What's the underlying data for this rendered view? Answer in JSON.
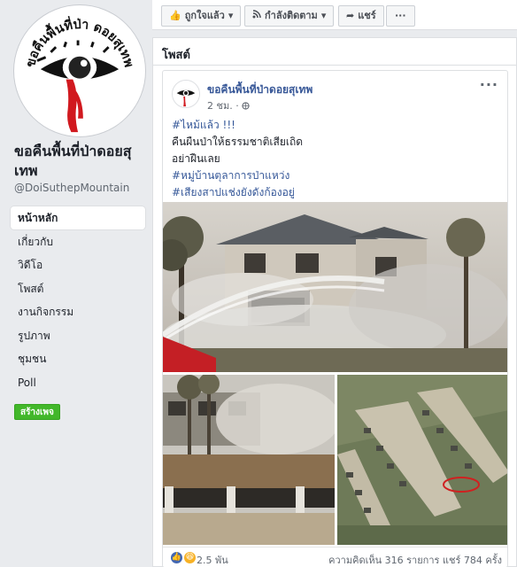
{
  "page": {
    "avatar_text": "ขอคืนพื้นที่ป่า ดอยสุเทพ",
    "name": "ขอคืนพื้นที่ป่าดอยสุเทพ",
    "handle": "@DoiSuthepMountain",
    "create_page_label": "สร้างเพจ"
  },
  "nav": {
    "items": [
      {
        "label": "หน้าหลัก",
        "active": true
      },
      {
        "label": "เกี่ยวกับ"
      },
      {
        "label": "วิดีโอ"
      },
      {
        "label": "โพสต์"
      },
      {
        "label": "งานกิจกรรม"
      },
      {
        "label": "รูปภาพ"
      },
      {
        "label": "ชุมชน"
      },
      {
        "label": "Poll"
      }
    ]
  },
  "top_bar": {
    "like_label": "ถูกใจแล้ว",
    "follow_label": "กำลังติดตาม",
    "share_label": "แชร์",
    "more_label": "···"
  },
  "posts": {
    "section_title": "โพสต์",
    "post": {
      "author": "ขอคืนพื้นที่ป่าดอยสุเทพ",
      "time": "2 ชม.",
      "privacy_sep": "·",
      "text_lines": [
        "#ไหม้แล้ว !!!",
        "คืนผืนป่าให้ธรรมชาติเสียเถิด",
        "อย่าฝืนเลย",
        "#หมู่บ้านตุลาการป่าแหว่ง",
        "#เสียงสาปแช่งยังดังก้องอยู่"
      ],
      "reactions_count": "2.5 พัน",
      "comments_shares": "ความคิดเห็น 316 รายการ  แชร์ 784 ครั้ง"
    }
  },
  "colors": {
    "accent_blue": "#385898",
    "hashtag_blue": "#365899",
    "create_green": "#42b72a",
    "bg_gray": "#e9ebee"
  }
}
